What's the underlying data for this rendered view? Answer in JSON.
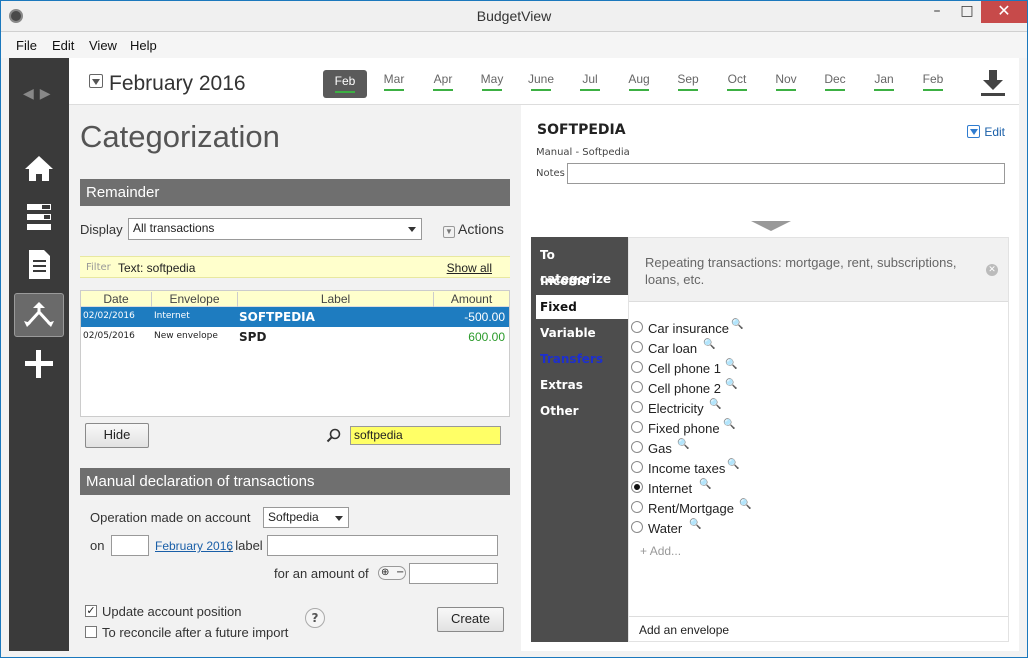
{
  "window": {
    "title": "BudgetView"
  },
  "menu": [
    "File",
    "Edit",
    "View",
    "Help"
  ],
  "header": {
    "month_title": "February 2016",
    "months": [
      "Feb",
      "Mar",
      "Apr",
      "May",
      "June",
      "Jul",
      "Aug",
      "Sep",
      "Oct",
      "Nov",
      "Dec",
      "Jan",
      "Feb"
    ],
    "selected_month": 0
  },
  "left": {
    "page_title": "Categorization",
    "remainder_title": "Remainder",
    "display_label": "Display",
    "display_value": "All transactions",
    "actions_label": "Actions",
    "filter_label": "Filter",
    "filter_text": "Text: softpedia",
    "show_all": "Show all",
    "columns": [
      "Date",
      "Envelope",
      "Label",
      "Amount"
    ],
    "rows": [
      {
        "date": "02/02/2016",
        "envelope": "Internet",
        "label": "SOFTPEDIA",
        "amount": "-500.00",
        "selected": true
      },
      {
        "date": "02/05/2016",
        "envelope": "New envelope",
        "label": "SPD",
        "amount": "600.00",
        "selected": false
      }
    ],
    "hide_button": "Hide",
    "search_value": "softpedia",
    "manual_title": "Manual declaration of transactions",
    "operation_label": "Operation made on account",
    "account_value": "Softpedia",
    "on_label": "on",
    "month_link": "February 2016",
    "label_label": ", label",
    "amount_label": "for an amount of",
    "update_label": "Update account position",
    "reconcile_label": "To reconcile after a future import",
    "create_button": "Create",
    "help_glyph": "?"
  },
  "right": {
    "title": "SOFTPEDIA",
    "subtitle": "Manual - Softpedia",
    "notes_label": "Notes",
    "edit_label": "Edit",
    "tabs": [
      {
        "label": "To categorize",
        "state": "normal"
      },
      {
        "label": "Income",
        "state": "normal"
      },
      {
        "label": "Fixed",
        "state": "active"
      },
      {
        "label": "Variable",
        "state": "normal"
      },
      {
        "label": "Transfers",
        "state": "link"
      },
      {
        "label": "Extras",
        "state": "normal"
      },
      {
        "label": "Other",
        "state": "normal"
      }
    ],
    "description": "Repeating transactions: mortgage, rent, subscriptions, loans, etc.",
    "envelopes": [
      {
        "name": "Car insurance",
        "checked": false
      },
      {
        "name": "Car loan",
        "checked": false
      },
      {
        "name": "Cell phone 1",
        "checked": false
      },
      {
        "name": "Cell phone 2",
        "checked": false
      },
      {
        "name": "Electricity",
        "checked": false
      },
      {
        "name": "Fixed phone",
        "checked": false
      },
      {
        "name": "Gas",
        "checked": false
      },
      {
        "name": "Income taxes",
        "checked": false
      },
      {
        "name": "Internet",
        "checked": true
      },
      {
        "name": "Rent/Mortgage",
        "checked": false
      },
      {
        "name": "Water",
        "checked": false
      }
    ],
    "add_link": "Add...",
    "add_envelope": "Add an envelope"
  },
  "colors": {
    "accent": "#1e7cc0",
    "positive": "#2a9a2a",
    "month_underline": "#3cb043",
    "transfers": "#1d2fcf"
  }
}
